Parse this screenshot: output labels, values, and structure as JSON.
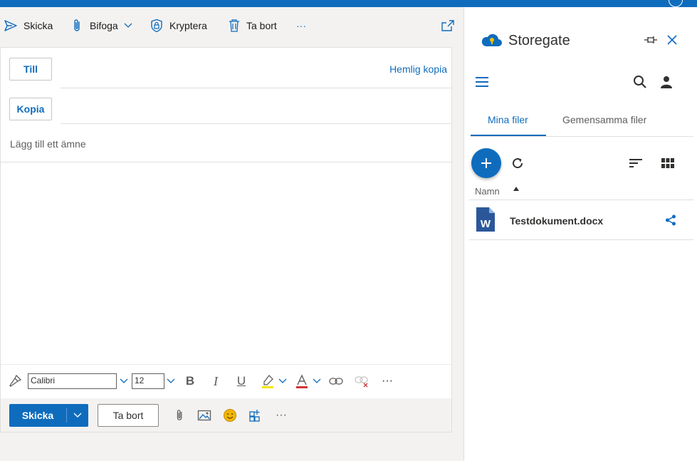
{
  "toolbar": {
    "send_label": "Skicka",
    "attach_label": "Bifoga",
    "encrypt_label": "Kryptera",
    "delete_label": "Ta bort",
    "more_label": "···"
  },
  "compose": {
    "to_label": "Till",
    "cc_label": "Kopia",
    "bcc_label": "Hemlig kopia",
    "subject_placeholder": "Lägg till ett ämne"
  },
  "format": {
    "font_name": "Calibri",
    "font_size": "12",
    "bold": "B",
    "italic": "I",
    "underline": "U",
    "more": "···"
  },
  "actions": {
    "send_label": "Skicka",
    "discard_label": "Ta bort",
    "more": "···"
  },
  "panel": {
    "title": "Storegate",
    "tabs": [
      {
        "label": "Mina filer",
        "active": true
      },
      {
        "label": "Gemensamma filer",
        "active": false
      }
    ],
    "column_name": "Namn",
    "files": [
      {
        "name": "Testdokument.docx",
        "icon": "word-file-icon"
      }
    ]
  },
  "colors": {
    "accent": "#0f6cbd",
    "word": "#2b579a",
    "emoji": "#f2b600"
  }
}
